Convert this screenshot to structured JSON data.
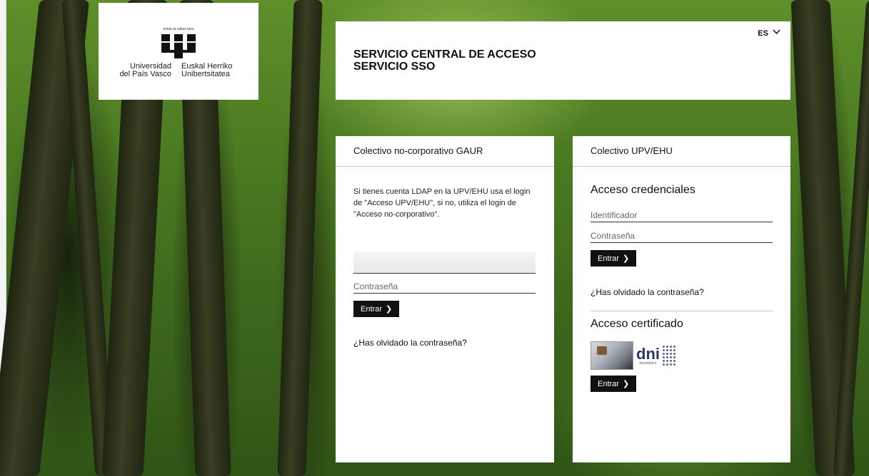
{
  "logo": {
    "motto": "eman ta zabal zazu",
    "name_es": [
      "Universidad",
      "del País Vasco"
    ],
    "name_eu": [
      "Euskal Herriko",
      "Unibertsitatea"
    ]
  },
  "header": {
    "title_line1": "SERVICIO CENTRAL DE ACCESO",
    "title_line2": "SERVICIO SSO",
    "language": "ES"
  },
  "gaur_panel": {
    "heading": "Colectivo no-corporativo GAUR",
    "info": "Si tienes cuenta LDAP en la UPV/EHU usa el login de \"Acceso UPV/EHU\", si no, utiliza el login de \"Acceso no-corporativo\".",
    "user_value": "",
    "password_placeholder": "Contraseña",
    "submit_label": "Entrar",
    "forgot_link": "¿Has olvidado la contraseña?"
  },
  "upv_panel": {
    "heading": "Colectivo UPV/EHU",
    "credentials_title": "Acceso credenciales",
    "user_placeholder": "Identificador",
    "password_placeholder": "Contraseña",
    "submit_label": "Entrar",
    "forgot_link": "¿Has olvidado la contraseña?",
    "certificate_title": "Acceso certificado",
    "dni_text": "dni",
    "dni_subtext": "electrónico",
    "certificate_submit_label": "Entrar"
  }
}
